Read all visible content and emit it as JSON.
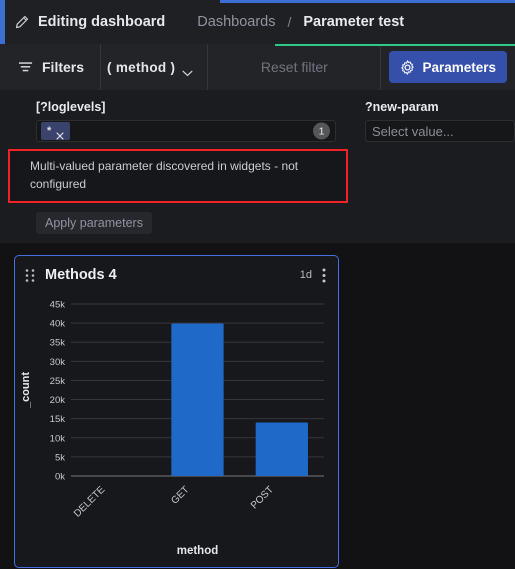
{
  "header": {
    "edit_label": "Editing dashboard",
    "pencil_icon": "pencil-icon",
    "breadcrumb_root": "Dashboards",
    "breadcrumb_separator": "/",
    "breadcrumb_current": "Parameter test",
    "accent_color": "#3b6fd4"
  },
  "filterbar": {
    "filters_label": "Filters",
    "filter_icon": "funnel-icon",
    "method_label": "( method )",
    "chevron_icon": "chevron-down-icon",
    "reset_label": "Reset filter",
    "parameters_label": "Parameters",
    "gear_icon": "gear-icon",
    "accent_color": "#2fc98d",
    "button_color": "#3550ab"
  },
  "parameters": {
    "left": {
      "label": "[?loglevels]",
      "chip_value": "*",
      "chip_remove_icon": "close-icon",
      "count_badge": "1"
    },
    "right": {
      "label": "?new-param",
      "placeholder": "Select value..."
    },
    "error_message": "Multi-valued parameter discovered in widgets - not configured",
    "error_border_color": "#f42222",
    "apply_label": "Apply parameters"
  },
  "panel": {
    "title": "Methods 4",
    "interval": "1d",
    "drag_icon": "drag-handle-icon",
    "menu_icon": "kebab-menu-icon",
    "border_color": "#4570e4"
  },
  "chart_data": {
    "type": "bar",
    "title": "Methods 4",
    "categories": [
      "DELETE",
      "GET",
      "POST"
    ],
    "values": [
      0,
      39900,
      14000
    ],
    "series": [
      {
        "name": "_count",
        "values": [
          0,
          39900,
          14000
        ]
      }
    ],
    "xlabel": "method",
    "ylabel": "_count",
    "ylim": [
      0,
      45000
    ],
    "ytick_labels": [
      "0k",
      "5k",
      "10k",
      "15k",
      "20k",
      "25k",
      "30k",
      "35k",
      "40k",
      "45k"
    ],
    "ytick_values": [
      0,
      5000,
      10000,
      15000,
      20000,
      25000,
      30000,
      35000,
      40000,
      45000
    ],
    "bar_color": "#1f69c8",
    "grid": true,
    "legend": "none",
    "xtick_rotation": -45
  }
}
